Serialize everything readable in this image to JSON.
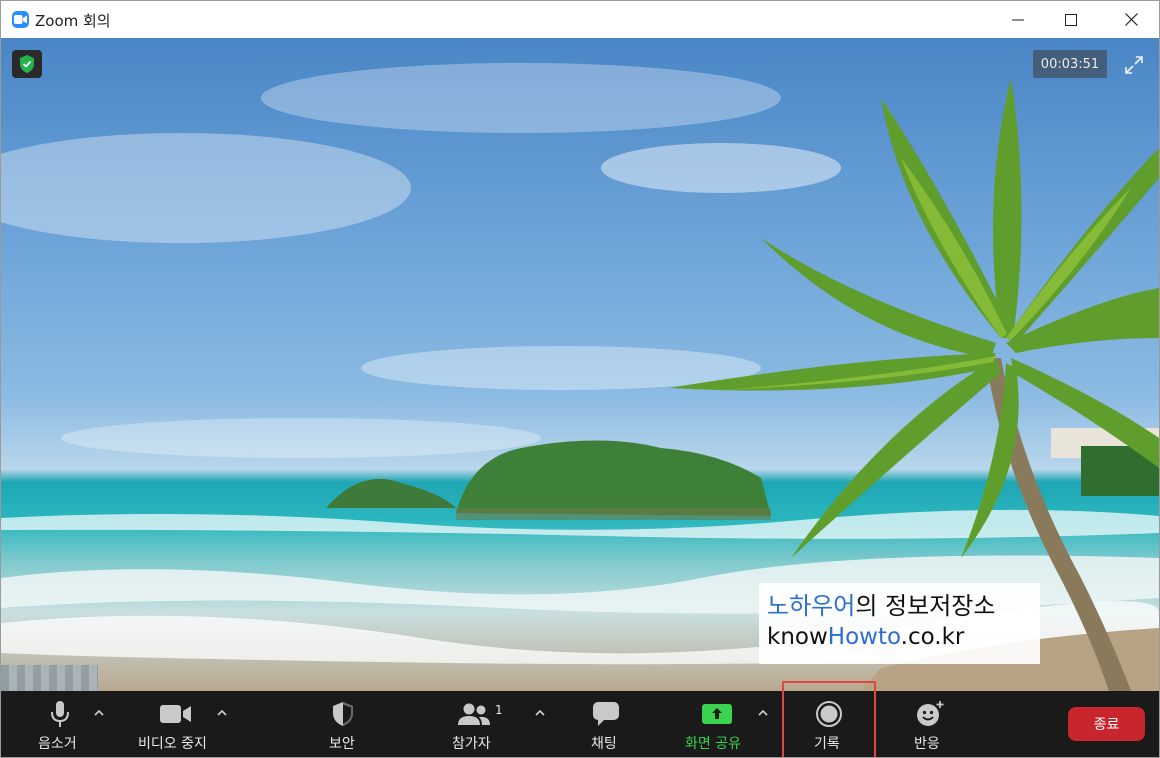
{
  "window": {
    "title": "Zoom 회의"
  },
  "meeting": {
    "timer": "00:03:51"
  },
  "watermark": {
    "line1_blue": "노하우어",
    "line1_rest": "의 정보저장소",
    "line2_pre": "know",
    "line2_blue": "Howto",
    "line2_post": ".co.kr"
  },
  "toolbar": {
    "mute_label": "음소거",
    "video_label": "비디오 중지",
    "security_label": "보안",
    "participants_label": "참가자",
    "participants_count": "1",
    "chat_label": "채팅",
    "share_label": "화면 공유",
    "record_label": "기록",
    "reactions_label": "반응",
    "end_label": "종료"
  },
  "colors": {
    "toolbar_bg": "#1a1a1a",
    "share_green": "#3ad34f",
    "end_red": "#c8252c",
    "highlight_red": "#e0473f",
    "zoom_blue": "#2d8cff"
  }
}
